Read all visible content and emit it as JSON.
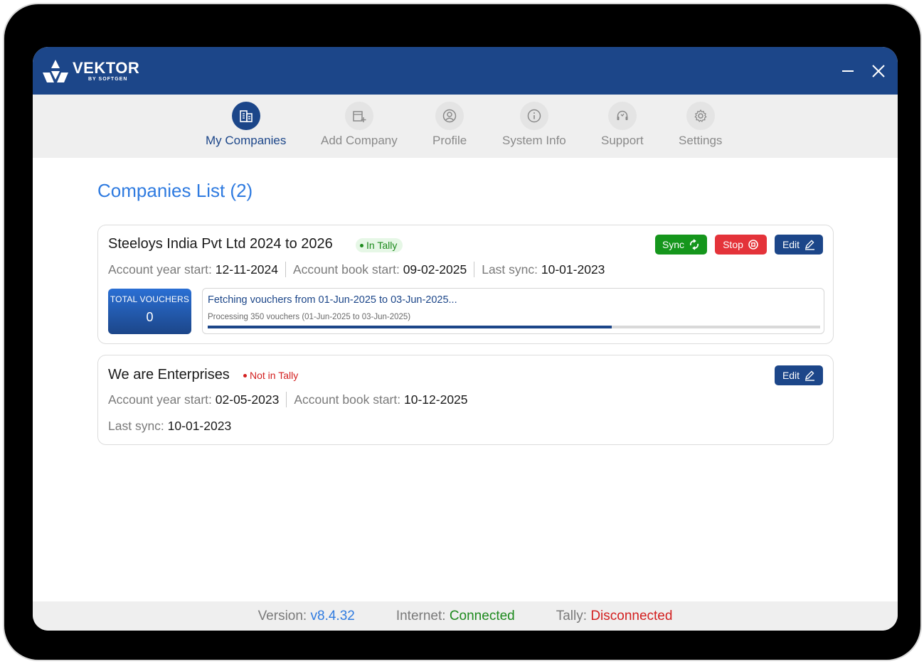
{
  "app": {
    "logo_name": "VEKTOR",
    "logo_sub": "BY SOFTGEN"
  },
  "nav": {
    "items": [
      {
        "label": "My Companies",
        "icon": "building-icon",
        "active": true
      },
      {
        "label": "Add Company",
        "icon": "add-building-icon",
        "active": false
      },
      {
        "label": "Profile",
        "icon": "user-circle-icon",
        "active": false
      },
      {
        "label": "System Info",
        "icon": "info-icon",
        "active": false
      },
      {
        "label": "Support",
        "icon": "headset-icon",
        "active": false
      },
      {
        "label": "Settings",
        "icon": "gear-icon",
        "active": false
      }
    ]
  },
  "page": {
    "title": "Companies List (2)"
  },
  "companies": [
    {
      "name": "Steeloys India Pvt Ltd 2024 to 2026",
      "status": "In Tally",
      "account_year_label": "Account year start:",
      "account_year": "12-11-2024",
      "book_start_label": "Account book start:",
      "book_start": "09-02-2025",
      "last_sync_label": "Last sync:",
      "last_sync": "10-01-2023",
      "buttons": {
        "sync": "Sync",
        "stop": "Stop",
        "edit": "Edit"
      },
      "vouchers_label": "TOTAL VOUCHERS",
      "vouchers_count": "0",
      "progress_title": "Fetching vouchers from 01-Jun-2025 to 03-Jun-2025...",
      "progress_sub": "Processing 350 vouchers (01-Jun-2025 to 03-Jun-2025)",
      "progress_fraction": 0.66
    },
    {
      "name": "We are Enterprises",
      "status": "Not in Tally",
      "account_year_label": "Account year start:",
      "account_year": "02-05-2023",
      "book_start_label": "Account book start:",
      "book_start": "10-12-2025",
      "last_sync_label": "Last sync:",
      "last_sync": "10-01-2023",
      "buttons": {
        "edit": "Edit"
      }
    }
  ],
  "statusbar": {
    "version_label": "Version:",
    "version": "v8.4.32",
    "internet_label": "Internet:",
    "internet": "Connected",
    "tally_label": "Tally:",
    "tally": "Disconnected"
  },
  "colors": {
    "primary": "#1c4689",
    "accent": "#2f7be0",
    "success": "#15961c",
    "danger": "#e4333a"
  }
}
